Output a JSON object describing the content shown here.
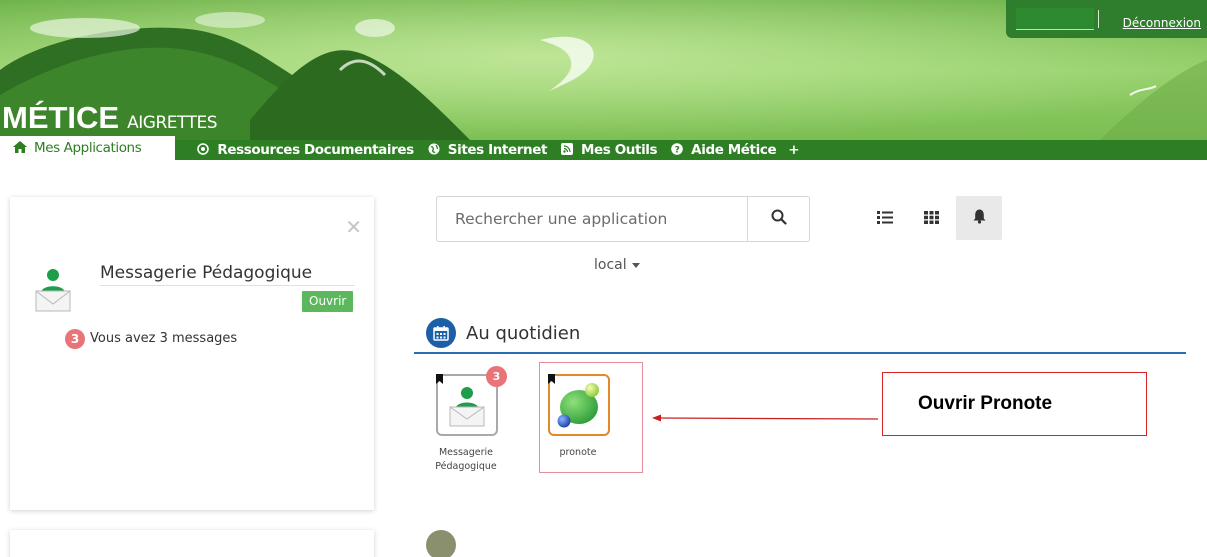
{
  "header": {
    "brand_main": "MÉTICE",
    "brand_sub": "AIGRETTES",
    "logout_label": "Déconnexion"
  },
  "nav": {
    "items": [
      {
        "label": "Mes Applications",
        "icon": "home-icon"
      },
      {
        "label": "Ressources Documentaires",
        "icon": "target-icon"
      },
      {
        "label": "Sites Internet",
        "icon": "globe-icon"
      },
      {
        "label": "Mes Outils",
        "icon": "rss-icon"
      },
      {
        "label": "Aide Métice",
        "icon": "help-icon"
      },
      {
        "label": "+",
        "icon": ""
      }
    ]
  },
  "notification_card": {
    "title": "Messagerie Pédagogique",
    "open_label": "Ouvrir",
    "badge": "3",
    "message": "Vous avez 3 messages"
  },
  "search": {
    "placeholder": "Rechercher une application"
  },
  "scope": {
    "label": "local"
  },
  "sections": [
    {
      "title": "Au quotidien",
      "apps": [
        {
          "label_line1": "Messagerie",
          "label_line2": "Pédagogique",
          "badge": "3"
        },
        {
          "label_line1": "pronote",
          "label_line2": ""
        }
      ]
    }
  ],
  "annotation": {
    "label": "Ouvrir Pronote"
  },
  "colors": {
    "nav_green": "#2e7e23",
    "header_green": "#8fcf65",
    "badge_red": "#e8747a",
    "open_green": "#5cb85c",
    "section_blue": "#1b5fa6",
    "callout_red": "#d62222"
  }
}
